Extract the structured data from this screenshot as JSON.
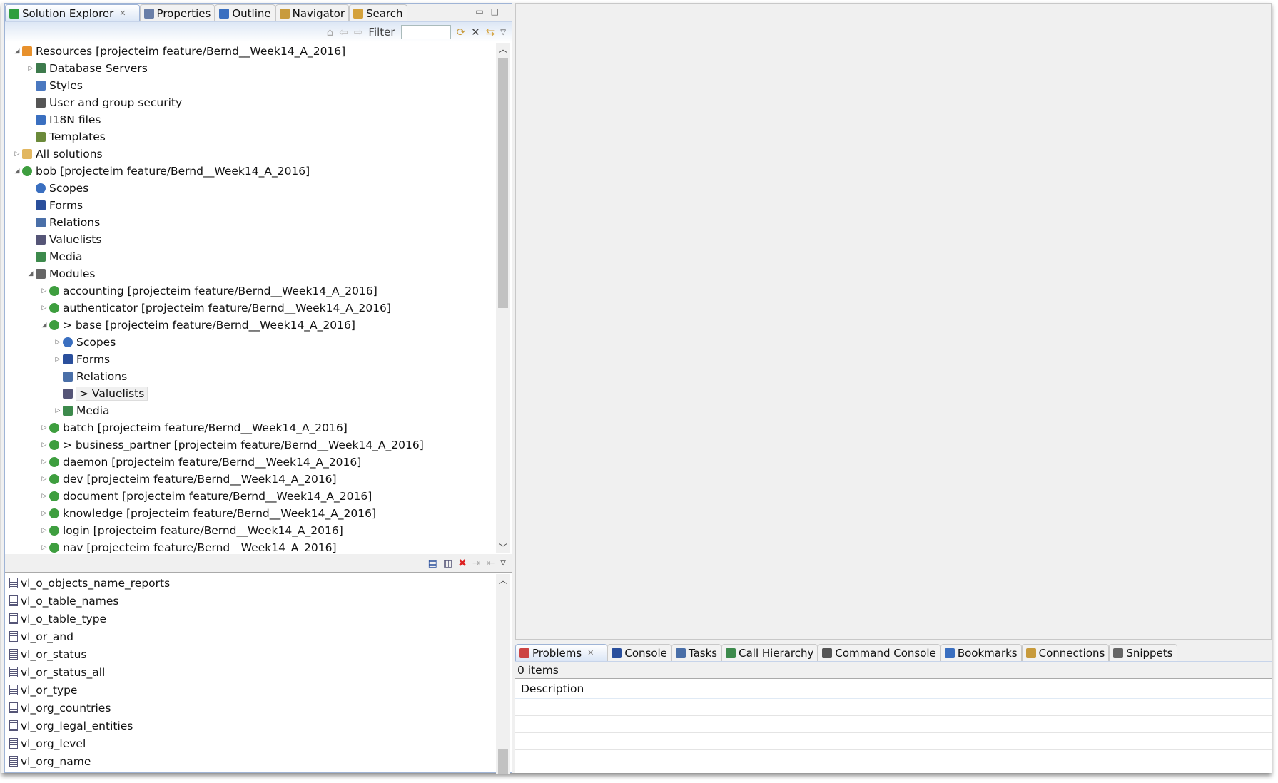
{
  "left_tabs": [
    {
      "label": "Solution Explorer",
      "icon": "solution-icon",
      "color": "#2e9e3f",
      "active": true
    },
    {
      "label": "Properties",
      "icon": "properties-icon",
      "color": "#6a7fa8"
    },
    {
      "label": "Outline",
      "icon": "outline-icon",
      "color": "#3a6fc0"
    },
    {
      "label": "Navigator",
      "icon": "navigator-icon",
      "color": "#c89b3c"
    },
    {
      "label": "Search",
      "icon": "search-icon",
      "color": "#d4a13a"
    }
  ],
  "filter_label": "Filter",
  "filter_value": "",
  "tree": [
    {
      "level": 0,
      "exp": "open",
      "icon": "resources-icon",
      "color": "#e8912c",
      "label": "Resources  [projecteim feature/Bernd__Week14_A_2016]"
    },
    {
      "level": 1,
      "exp": "closed",
      "icon": "database-icon",
      "color": "#3d7a4c",
      "label": "Database Servers"
    },
    {
      "level": 1,
      "exp": "",
      "icon": "styles-icon",
      "color": "#4a78c0",
      "label": "Styles"
    },
    {
      "level": 1,
      "exp": "",
      "icon": "security-icon",
      "color": "#555",
      "label": "User and group security"
    },
    {
      "level": 1,
      "exp": "",
      "icon": "i18n-icon",
      "color": "#3a6fc0",
      "label": "I18N files"
    },
    {
      "level": 1,
      "exp": "",
      "icon": "templates-icon",
      "color": "#6b8a3a",
      "label": "Templates"
    },
    {
      "level": 0,
      "exp": "closed",
      "icon": "folder-icon",
      "color": "#e2b760",
      "label": "All solutions"
    },
    {
      "level": 0,
      "exp": "open",
      "icon": "solution-icon",
      "color": "#3e9e3f",
      "label": "bob  [projecteim feature/Bernd__Week14_A_2016]"
    },
    {
      "level": 1,
      "exp": "",
      "icon": "scopes-icon",
      "color": "#3a6fc0",
      "label": "Scopes"
    },
    {
      "level": 1,
      "exp": "",
      "icon": "forms-icon",
      "color": "#2a4f9c",
      "label": "Forms"
    },
    {
      "level": 1,
      "exp": "",
      "icon": "relations-icon",
      "color": "#4a6fa8",
      "label": "Relations"
    },
    {
      "level": 1,
      "exp": "",
      "icon": "valuelists-icon",
      "color": "#557",
      "label": "Valuelists"
    },
    {
      "level": 1,
      "exp": "",
      "icon": "media-icon",
      "color": "#3d8a4c",
      "label": "Media"
    },
    {
      "level": 1,
      "exp": "open",
      "icon": "modules-icon",
      "color": "#666",
      "label": "Modules"
    },
    {
      "level": 2,
      "exp": "closed",
      "icon": "module-icon",
      "color": "#3e9e3f",
      "label": "accounting  [projecteim feature/Bernd__Week14_A_2016]"
    },
    {
      "level": 2,
      "exp": "closed",
      "icon": "module-icon",
      "color": "#3e9e3f",
      "label": "authenticator  [projecteim feature/Bernd__Week14_A_2016]"
    },
    {
      "level": 2,
      "exp": "open",
      "icon": "module-icon",
      "color": "#3e9e3f",
      "label": "> base  [projecteim feature/Bernd__Week14_A_2016]"
    },
    {
      "level": 3,
      "exp": "closed",
      "icon": "scopes-icon",
      "color": "#3a6fc0",
      "label": "Scopes"
    },
    {
      "level": 3,
      "exp": "closed",
      "icon": "forms-icon",
      "color": "#2a4f9c",
      "label": "Forms"
    },
    {
      "level": 3,
      "exp": "",
      "icon": "relations-icon",
      "color": "#4a6fa8",
      "label": "Relations"
    },
    {
      "level": 3,
      "exp": "",
      "icon": "valuelists-icon",
      "color": "#557",
      "label": "> Valuelists",
      "selected": true
    },
    {
      "level": 3,
      "exp": "closed",
      "icon": "media-icon",
      "color": "#3d8a4c",
      "label": "Media"
    },
    {
      "level": 2,
      "exp": "closed",
      "icon": "module-icon",
      "color": "#3e9e3f",
      "label": "batch  [projecteim feature/Bernd__Week14_A_2016]"
    },
    {
      "level": 2,
      "exp": "closed",
      "icon": "module-icon",
      "color": "#3e9e3f",
      "label": "> business_partner  [projecteim feature/Bernd__Week14_A_2016]"
    },
    {
      "level": 2,
      "exp": "closed",
      "icon": "module-icon",
      "color": "#3e9e3f",
      "label": "daemon  [projecteim feature/Bernd__Week14_A_2016]"
    },
    {
      "level": 2,
      "exp": "closed",
      "icon": "module-icon",
      "color": "#3e9e3f",
      "label": "dev  [projecteim feature/Bernd__Week14_A_2016]"
    },
    {
      "level": 2,
      "exp": "closed",
      "icon": "module-icon",
      "color": "#3e9e3f",
      "label": "document  [projecteim feature/Bernd__Week14_A_2016]"
    },
    {
      "level": 2,
      "exp": "closed",
      "icon": "module-icon",
      "color": "#3e9e3f",
      "label": "knowledge  [projecteim feature/Bernd__Week14_A_2016]"
    },
    {
      "level": 2,
      "exp": "closed",
      "icon": "module-icon",
      "color": "#3e9e3f",
      "label": "login  [projecteim feature/Bernd__Week14_A_2016]"
    },
    {
      "level": 2,
      "exp": "closed",
      "icon": "module-icon",
      "color": "#3e9e3f",
      "label": "nav  [projecteim feature/Bernd__Week14_A_2016]"
    }
  ],
  "list": [
    "vl_o_objects_name_reports",
    "vl_o_table_names",
    "vl_o_table_type",
    "vl_or_and",
    "vl_or_status",
    "vl_or_status_all",
    "vl_or_type",
    "vl_org_countries",
    "vl_org_legal_entities",
    "vl_org_level",
    "vl_org_name"
  ],
  "bottom_tabs": [
    {
      "label": "Problems",
      "icon": "problems-icon",
      "color": "#c44",
      "active": true
    },
    {
      "label": "Console",
      "icon": "console-icon",
      "color": "#2a4f9c"
    },
    {
      "label": "Tasks",
      "icon": "tasks-icon",
      "color": "#4a6fa8"
    },
    {
      "label": "Call Hierarchy",
      "icon": "call-hierarchy-icon",
      "color": "#3d8a4c"
    },
    {
      "label": "Command Console",
      "icon": "command-console-icon",
      "color": "#555"
    },
    {
      "label": "Bookmarks",
      "icon": "bookmarks-icon",
      "color": "#3a6fc0"
    },
    {
      "label": "Connections",
      "icon": "connections-icon",
      "color": "#c89b3c"
    },
    {
      "label": "Snippets",
      "icon": "snippets-icon",
      "color": "#666"
    }
  ],
  "problems": {
    "status": "0 items",
    "column": "Description"
  }
}
